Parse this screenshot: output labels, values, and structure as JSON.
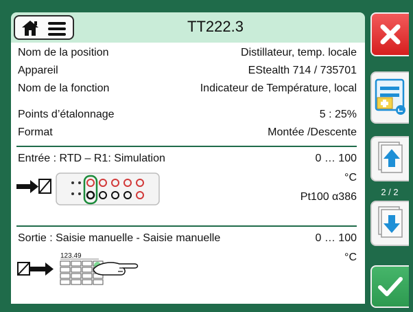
{
  "header": {
    "title": "TT222.3"
  },
  "info": {
    "position_name_label": "Nom de la position",
    "position_name_value": "Distillateur, temp. locale",
    "device_label": "Appareil",
    "device_value": "EStealth 714 / 735701",
    "function_label": "Nom de la fonction",
    "function_value": "Indicateur de Température, local",
    "points_label": "Points d’étalonnage",
    "points_value": "5 : 25%",
    "format_label": "Format",
    "format_value": "Montée /Descente"
  },
  "input": {
    "label": "Entrée :  RTD – R1: Simulation",
    "range": "0 … 100",
    "unit": "°C",
    "sensor": "Pt100 α386"
  },
  "output": {
    "label": "Sortie : Saisie manuelle - Saisie manuelle",
    "range": "0 … 100",
    "unit": "°C",
    "keypad_display": "123.49"
  },
  "navigation": {
    "page_indicator": "2 / 2"
  },
  "icons": {
    "home": "home-icon",
    "menu": "hamburger-menu-icon",
    "close": "close-icon",
    "list_add": "list-add-icon",
    "page_up": "page-up-icon",
    "page_down": "page-down-icon",
    "ok": "checkmark-icon"
  },
  "colors": {
    "background": "#1f6b4a",
    "header": "#c9ecd8",
    "close": "#e02b2b",
    "ok": "#35a55a",
    "arrow_blue": "#1e8fd6"
  }
}
